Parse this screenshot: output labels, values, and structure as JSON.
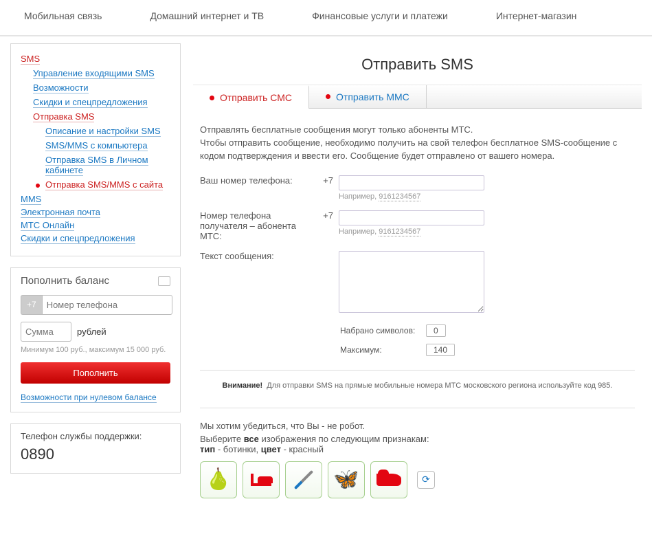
{
  "topnav": [
    "Мобильная связь",
    "Домашний интернет и ТВ",
    "Финансовые услуги и платежи",
    "Интернет-магазин"
  ],
  "sidebar": {
    "sms": "SMS",
    "items": [
      "Управление входящими SMS",
      "Возможности",
      "Скидки и спецпредложения",
      "Отправка SMS"
    ],
    "sub": [
      "Описание и настройки SMS",
      "SMS/MMS с компьютера",
      "Отправка SMS в Личном кабинете",
      "Отправка SMS/MMS с сайта"
    ],
    "rest": [
      "MMS",
      "Электронная почта",
      "МТС Онлайн",
      "Скидки и спецпредложения"
    ]
  },
  "topup": {
    "title": "Пополнить баланс",
    "prefix": "+7",
    "phone_ph": "Номер телефона",
    "sum_ph": "Сумма",
    "rub": "рублей",
    "hint": "Минимум 100 руб., максимум 15 000 руб.",
    "btn": "Пополнить",
    "zero_link": "Возможности при нулевом балансе"
  },
  "support": {
    "label": "Телефон службы поддержки:",
    "num": "0890"
  },
  "main": {
    "title": "Отправить SMS",
    "tab_sms": "Отправить СМС",
    "tab_mms": "Отправить ММС",
    "intro1": "Отправлять бесплатные сообщения могут только абоненты МТС.",
    "intro2": "Чтобы отправить сообщение, необходимо получить на свой телефон бесплатное SMS-сообщение с кодом подтверждения и ввести его. Сообщение будет отправлено от вашего номера.",
    "your_phone": "Ваш номер телефона:",
    "recip_phone": "Номер телефона получателя – абонента МТС:",
    "prefix": "+7",
    "example_lbl": "Например, ",
    "example_num": "9161234567",
    "msg_label": "Текст сообщения:",
    "chars_label": "Набрано символов:",
    "chars_val": "0",
    "max_label": "Максимум:",
    "max_val": "140",
    "warn_b": "Внимание!",
    "warn_t": "Для отправки SMS на прямые мобильные номера МТС московского региона используйте код 985.",
    "cap1": "Мы хотим убедиться, что Вы - не робот.",
    "cap2a": "Выберите ",
    "cap2b": "все",
    "cap2c": " изображения по следующим признакам:",
    "cap3a": "тип",
    "cap3b": " - ботинки, ",
    "cap3c": "цвет",
    "cap3d": " - красный"
  }
}
